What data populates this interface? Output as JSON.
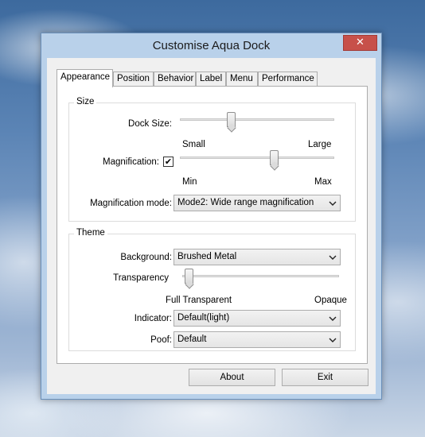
{
  "window": {
    "title": "Customise Aqua Dock",
    "close_glyph": "✕"
  },
  "tabs": [
    {
      "label": "Appearance",
      "active": true
    },
    {
      "label": "Position"
    },
    {
      "label": "Behavior"
    },
    {
      "label": "Label"
    },
    {
      "label": "Menu"
    },
    {
      "label": "Performance"
    }
  ],
  "size_group": {
    "title": "Size",
    "dock_size": {
      "label": "Dock Size:",
      "min_label": "Small",
      "max_label": "Large",
      "value": 0.33
    },
    "magnification": {
      "label": "Magnification:",
      "checked": true,
      "check_glyph": "✔",
      "min_label": "Min",
      "max_label": "Max",
      "value": 0.61
    },
    "magnification_mode": {
      "label": "Magnification mode:",
      "selected": "Mode2: Wide range magnification"
    }
  },
  "theme_group": {
    "title": "Theme",
    "background": {
      "label": "Background:",
      "selected": "Brushed Metal"
    },
    "transparency": {
      "label": "Transparency",
      "min_label": "Full Transparent",
      "max_label": "Opaque",
      "value": 0.04
    },
    "indicator": {
      "label": "Indicator:",
      "selected": "Default(light)"
    },
    "poof": {
      "label": "Poof:",
      "selected": "Default"
    }
  },
  "buttons": {
    "about": "About",
    "exit": "Exit"
  },
  "icons": {
    "close": "close-icon",
    "dropdown": "chevron-down-icon",
    "check": "checkmark-icon"
  },
  "colors": {
    "window_frame": "#b9d1ea",
    "close_button": "#c7504a",
    "client_bg": "#f0f0f0",
    "panel_bg": "#ffffff"
  }
}
